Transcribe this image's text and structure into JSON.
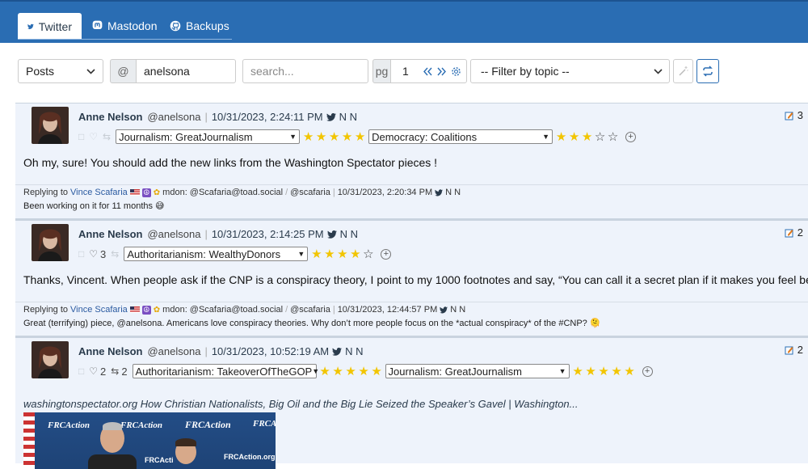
{
  "tabs": [
    {
      "label": "Twitter",
      "active": true
    },
    {
      "label": "Mastodon",
      "active": false
    },
    {
      "label": "Backups",
      "active": false
    }
  ],
  "toolbar": {
    "type_select": "Posts",
    "at_addon": "@",
    "user_value": "anelsona",
    "search_placeholder": "search...",
    "pg_addon": "pg",
    "page_value": "1",
    "topic_filter": "-- Filter by topic --"
  },
  "posts": [
    {
      "name": "Anne Nelson",
      "handle": "@anelsona",
      "date": "10/31/2023, 2:24:11 PM",
      "flags": "N N",
      "likes": "",
      "retweets": "",
      "topics": [
        {
          "label": "Journalism: GreatJournalism",
          "stars": 5
        },
        {
          "label": "Democracy: Coalitions",
          "stars": 3
        }
      ],
      "text": "Oh my, sure! You should add the new links from the Washington Spectator pieces !",
      "badge": "3",
      "reply": {
        "prefix": "Replying to",
        "to": "Vince Scafaria",
        "mdon": "mdon: @Scafaria@toad.social",
        "handle": "@scafaria",
        "date": "10/31/2023, 2:20:34 PM",
        "flags": "N N",
        "text": "Been working on it for 11 months 😅"
      }
    },
    {
      "name": "Anne Nelson",
      "handle": "@anelsona",
      "date": "10/31/2023, 2:14:25 PM",
      "flags": "N N",
      "likes": "3",
      "retweets": "",
      "topics": [
        {
          "label": "Authoritarianism: WealthyDonors",
          "stars": 4
        }
      ],
      "text": "Thanks, Vincent. When people ask if the CNP is a conspiracy theory, I point to my 1000 footnotes and say, “You can call it a secret plan if it makes you feel better.”",
      "badge": "2",
      "reply": {
        "prefix": "Replying to",
        "to": "Vince Scafaria",
        "mdon": "mdon: @Scafaria@toad.social",
        "handle": "@scafaria",
        "date": "10/31/2023, 12:44:57 PM",
        "flags": "N N",
        "text": "Great (terrifying) piece, @anelsona. Americans love conspiracy theories. Why don’t more people focus on the *actual conspiracy* of the #CNP? 🫠"
      }
    },
    {
      "name": "Anne Nelson",
      "handle": "@anelsona",
      "date": "10/31/2023, 10:52:19 AM",
      "flags": "N N",
      "likes": "2",
      "retweets": "2",
      "topics": [
        {
          "label": "Authoritarianism: TakeoverOfTheGOP",
          "stars": 5
        },
        {
          "label": "Journalism: GreatJournalism",
          "stars": 5
        }
      ],
      "link_title": "washingtonspectator.org How Christian Nationalists, Big Oil and the Big Lie Seized the Speaker’s Gavel | Washington...",
      "image_logos": [
        "FRCAction",
        "FRCAction",
        "FRCAction",
        "FRCAction",
        "FRCActi",
        "FRCAction.org"
      ],
      "badge": "2"
    }
  ],
  "colors": {
    "header_blue": "#2a6db3",
    "post_bg": "#eef3fb",
    "star_gold": "#f2c500",
    "link_blue": "#2a5aa0"
  }
}
